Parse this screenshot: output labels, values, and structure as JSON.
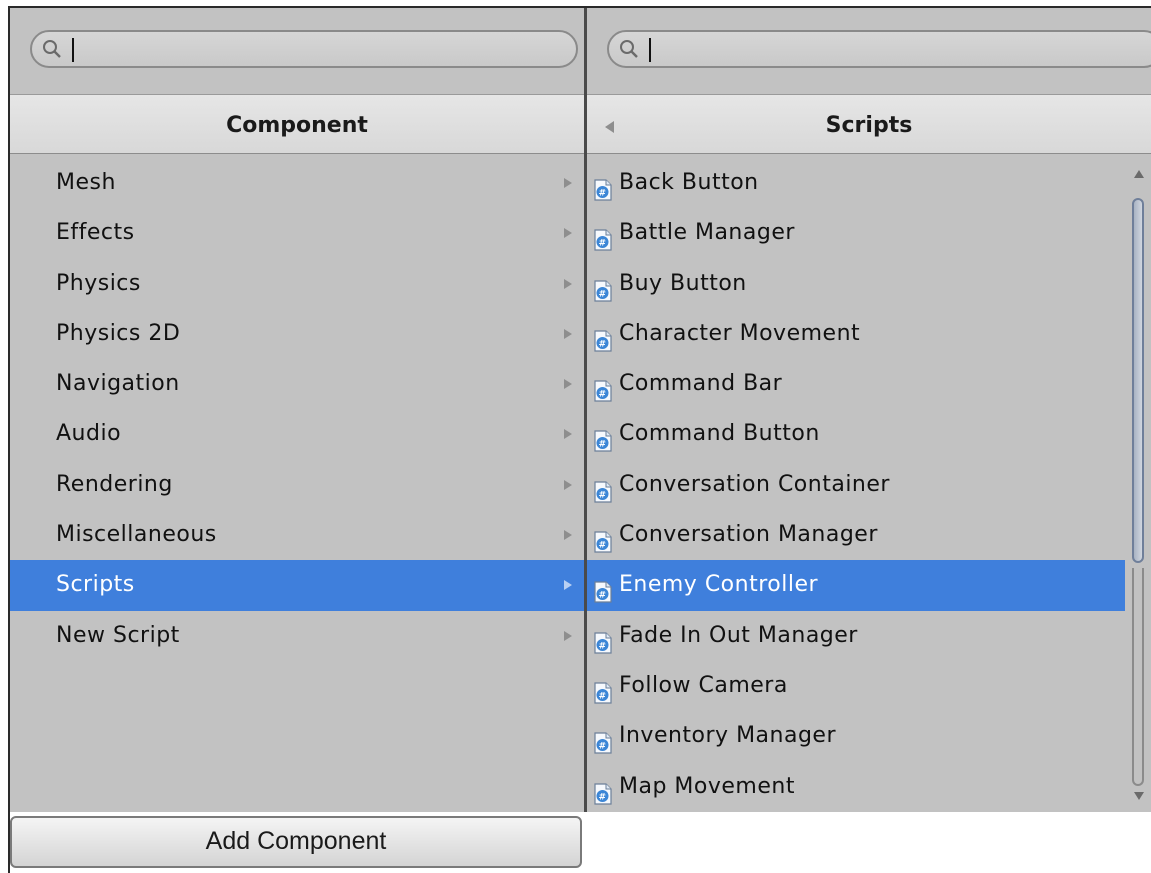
{
  "left_panel": {
    "search": {
      "value": ""
    },
    "header_title": "Component",
    "items": [
      {
        "label": "Mesh"
      },
      {
        "label": "Effects"
      },
      {
        "label": "Physics"
      },
      {
        "label": "Physics 2D"
      },
      {
        "label": "Navigation"
      },
      {
        "label": "Audio"
      },
      {
        "label": "Rendering"
      },
      {
        "label": "Miscellaneous"
      },
      {
        "label": "Scripts",
        "selected": true
      },
      {
        "label": "New Script"
      }
    ]
  },
  "right_panel": {
    "search": {
      "value": ""
    },
    "header_title": "Scripts",
    "items": [
      {
        "label": "Back Button"
      },
      {
        "label": "Battle Manager"
      },
      {
        "label": "Buy Button"
      },
      {
        "label": "Character Movement"
      },
      {
        "label": "Command Bar"
      },
      {
        "label": "Command Button"
      },
      {
        "label": "Conversation Container"
      },
      {
        "label": "Conversation Manager"
      },
      {
        "label": "Enemy Controller",
        "selected": true
      },
      {
        "label": "Fade In Out Manager"
      },
      {
        "label": "Follow Camera"
      },
      {
        "label": "Inventory Manager"
      },
      {
        "label": "Map Movement"
      }
    ],
    "item_icon": "csharp-script-icon"
  },
  "add_component_label": "Add Component",
  "colors": {
    "panel_bg": "#c2c2c2",
    "selection": "#3f7fdc",
    "header_bg": "#e0e0e0"
  }
}
